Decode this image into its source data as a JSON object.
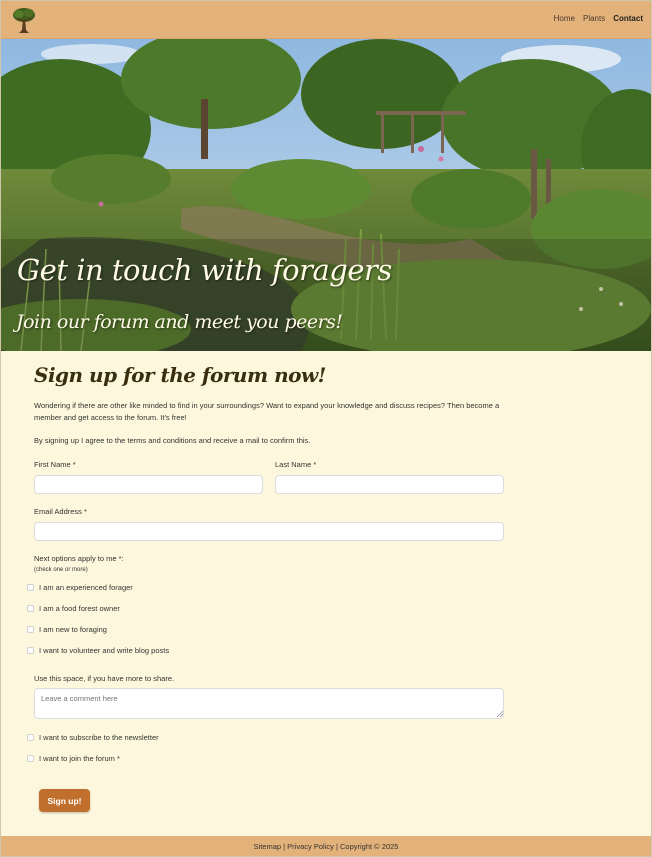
{
  "nav": {
    "links": [
      {
        "label": "Home"
      },
      {
        "label": "Plants"
      },
      {
        "label": "Contact"
      }
    ]
  },
  "hero": {
    "title": "Get in touch with foragers",
    "subtitle": "Join our forum and meet you peers!"
  },
  "form": {
    "heading": "Sign up for the forum now!",
    "intro": "Wondering if there are other like minded to find in your surroundings? Want to expand your knowledge and discuss recipes? Then become a member and get access to the forum. It's free!",
    "terms": "By signing up I agree to the terms and conditions and receive a mail to confirm this.",
    "first_name_label": "First Name *",
    "last_name_label": "Last Name *",
    "email_label": "Email Address *",
    "first_name_value": "",
    "last_name_value": "",
    "email_value": "",
    "options_label": "Next options apply to me *:",
    "options_hint": "(check one or more)",
    "options": [
      {
        "label": "I am an experienced forager",
        "checked": false
      },
      {
        "label": "I am a food forest owner",
        "checked": false
      },
      {
        "label": "I am new to foraging",
        "checked": false
      },
      {
        "label": "I want to volunteer and write blog posts",
        "checked": false
      }
    ],
    "comment_label": "Use this space, if you have more to share.",
    "comment_placeholder": "Leave a comment here",
    "newsletter_label": "I want to subscribe to the newsletter",
    "join_label": "I want to join the forum *",
    "submit_label": "Sign up!"
  },
  "footer": {
    "sitemap": "Sitemap",
    "sep1": " | ",
    "privacy": "Privacy Policy",
    "sep2": " | ",
    "copyright": "Copyright © 2025"
  },
  "colors": {
    "nav_bg": "#e3b27a",
    "page_bg": "#fdf8dd",
    "button": "#c0702c"
  },
  "icons": {
    "logo": "tree-logo-icon"
  }
}
